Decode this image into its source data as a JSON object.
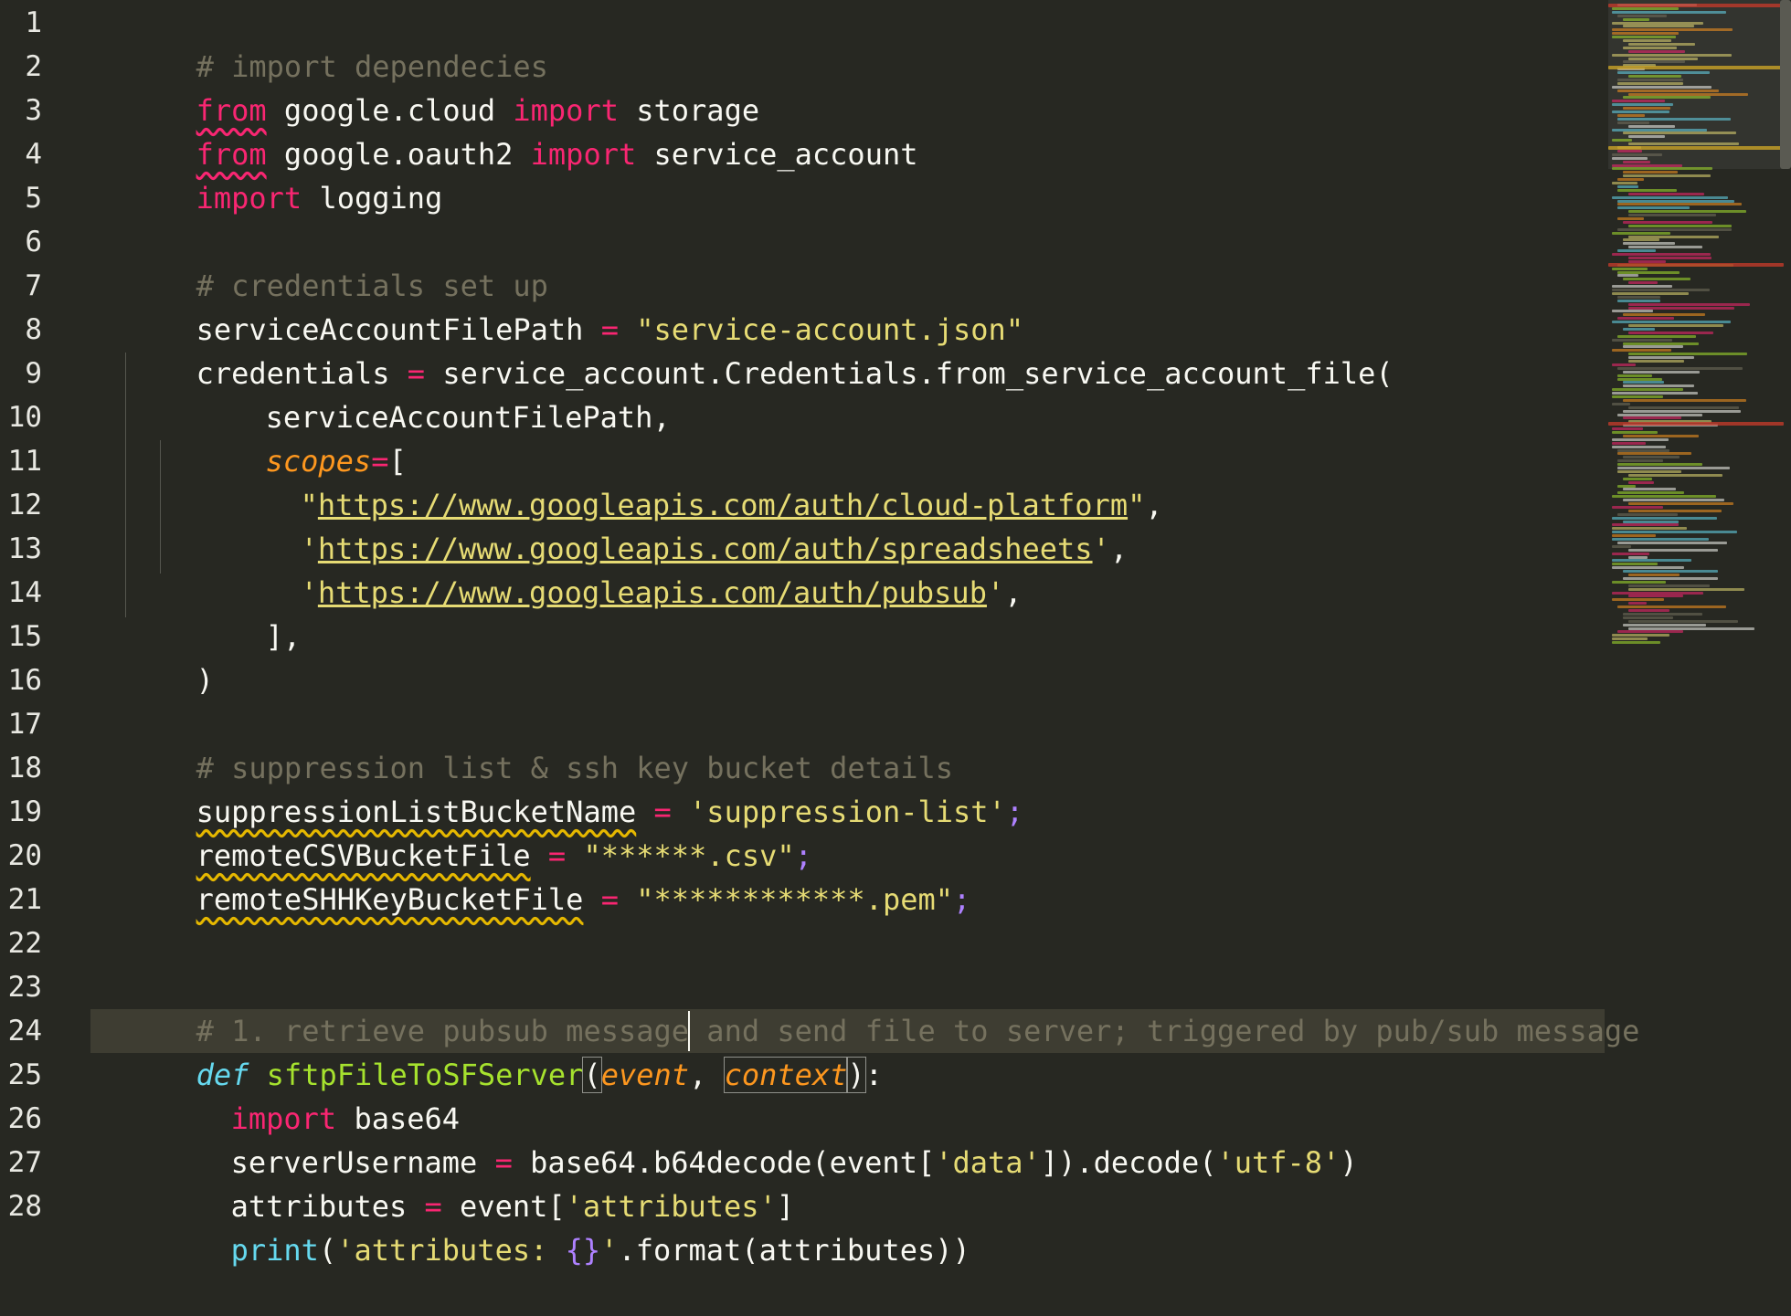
{
  "editor": {
    "colors": {
      "background": "#272822",
      "keyword": "#f92672",
      "comment": "#75715e",
      "string": "#e6db74",
      "function": "#a6e22e",
      "def": "#66d9ef",
      "param": "#fd971f"
    },
    "line_numbers": [
      "1",
      "2",
      "3",
      "4",
      "5",
      "6",
      "7",
      "8",
      "9",
      "10",
      "11",
      "12",
      "13",
      "14",
      "15",
      "16",
      "17",
      "18",
      "19",
      "20",
      "21",
      "22",
      "23",
      "24",
      "25",
      "26",
      "27",
      "28"
    ],
    "lines": {
      "l1": {
        "t0": "# import dependecies"
      },
      "l2": {
        "t0": "from",
        "t1": " google.cloud ",
        "t2": "import",
        "t3": " storage"
      },
      "l3": {
        "t0": "from",
        "t1": " google.oauth2 ",
        "t2": "import",
        "t3": " service_account"
      },
      "l4": {
        "t0": "import",
        "t1": " logging"
      },
      "l6": {
        "t0": "# credentials set up"
      },
      "l7": {
        "t0": "serviceAccountFilePath ",
        "t1": "=",
        "t2": " ",
        "t3": "\"service-account.json\""
      },
      "l8": {
        "t0": "credentials ",
        "t1": "=",
        "t2": " service_account.Credentials.from_service_account_file("
      },
      "l9": {
        "t0": "serviceAccountFilePath,"
      },
      "l10": {
        "t0": "scopes",
        "t1": "=",
        "t2": "["
      },
      "l11": {
        "t0": "\"",
        "t1": "https://www.googleapis.com/auth/cloud-platform",
        "t2": "\"",
        "t3": ","
      },
      "l12": {
        "t0": "'",
        "t1": "https://www.googleapis.com/auth/spreadsheets",
        "t2": "'",
        "t3": ","
      },
      "l13": {
        "t0": "'",
        "t1": "https://www.googleapis.com/auth/pubsub",
        "t2": "'",
        "t3": ","
      },
      "l14": {
        "t0": "],"
      },
      "l15": {
        "t0": ")"
      },
      "l17": {
        "t0": "# suppression list & ssh key bucket details"
      },
      "l18": {
        "t0": "suppressionListBucketName",
        "t1": " ",
        "t2": "=",
        "t3": " ",
        "t4": "'suppression-list'",
        "t5": ";"
      },
      "l19": {
        "t0": "remoteCSVBucketFile",
        "t1": " ",
        "t2": "=",
        "t3": " ",
        "t4": "\"******.csv\"",
        "t5": ";"
      },
      "l20": {
        "t0": "remoteSHHKeyBucketFile",
        "t1": " ",
        "t2": "=",
        "t3": " ",
        "t4": "\"************.pem\"",
        "t5": ";"
      },
      "l23": {
        "t0": "# 1. retrieve pubsub message and send file to server; triggered by pub/sub message"
      },
      "l24": {
        "t0": "def",
        "t1": " ",
        "t2": "sftpFileToSFServer",
        "t3": "(",
        "t4": "event",
        "t5": ", ",
        "t6": "context",
        "t7": ")",
        "t8": ":"
      },
      "l25": {
        "t0": "import",
        "t1": " base64"
      },
      "l26": {
        "t0": "serverUsername ",
        "t1": "=",
        "t2": " base64.b64decode(event[",
        "t3": "'data'",
        "t4": "]).decode(",
        "t5": "'utf-8'",
        "t6": ")"
      },
      "l27": {
        "t0": "attributes ",
        "t1": "=",
        "t2": " event[",
        "t3": "'attributes'",
        "t4": "]"
      },
      "l28": {
        "t0": "print",
        "t1": "(",
        "t2": "'attributes: ",
        "t3": "{}",
        "t4": "'",
        "t5": ".format(attributes))"
      }
    }
  }
}
